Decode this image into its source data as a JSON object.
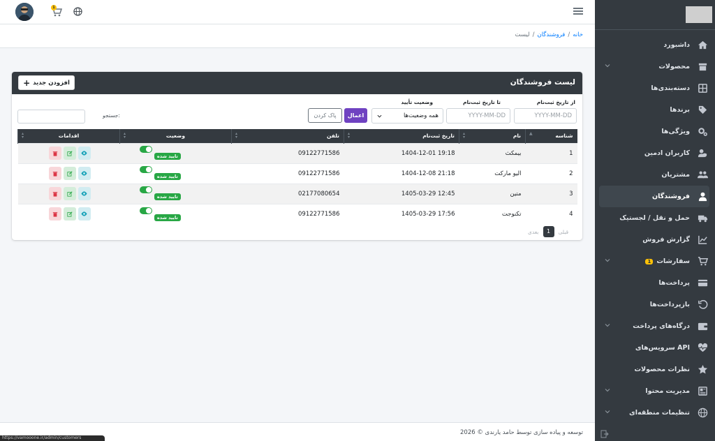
{
  "header": {
    "cart_count": "1"
  },
  "breadcrumb": {
    "home": "خانه",
    "section": "فروشندگان",
    "current": "لیست",
    "sep": "/"
  },
  "sidebar": {
    "items": [
      {
        "label": "داشبورد",
        "icon": "home-icon"
      },
      {
        "label": "محصولات",
        "icon": "box-icon"
      },
      {
        "label": "دسته‌بندی‌ها",
        "icon": "grid-icon"
      },
      {
        "label": "برندها",
        "icon": "tag-icon"
      },
      {
        "label": "ویژگی‌ها",
        "icon": "gears-icon"
      },
      {
        "label": "کاربران ادمین",
        "icon": "user-shield-icon"
      },
      {
        "label": "مشتریان",
        "icon": "users-icon"
      },
      {
        "label": "فروشندگان",
        "icon": "user-tie-icon"
      },
      {
        "label": "حمل و نقل / لجستیک",
        "icon": "truck-icon"
      },
      {
        "label": "گزارش فروش",
        "icon": "chart-line-icon"
      },
      {
        "label": "سفارشات",
        "icon": "cart-icon",
        "badge": "1"
      },
      {
        "label": "پرداخت‌ها",
        "icon": "credit-card-icon"
      },
      {
        "label": "بازپرداخت‌ها",
        "icon": "undo-icon"
      },
      {
        "label": "درگاه‌های پرداخت",
        "icon": "wallet-icon"
      },
      {
        "label": "سرویس‌های API",
        "icon": "heartbeat-icon"
      },
      {
        "label": "نظرات محصولات",
        "icon": "star-icon"
      },
      {
        "label": "مدیریت محتوا",
        "icon": "newspaper-icon"
      },
      {
        "label": "تنظیمات منطقه‌ای",
        "icon": "globe-icon"
      }
    ]
  },
  "card": {
    "title": "لیست فروشندگان",
    "add_label": "افزودن جدید",
    "filters": {
      "from_label": "از تاریخ ثبت‌نام",
      "from_placeholder": "YYYY-MM-DD",
      "to_label": "تا تاریخ ثبت‌نام",
      "to_placeholder": "YYYY-MM-DD",
      "status_label": "وضعیت تأیید",
      "status_value": "همه وضعیت‌ها",
      "apply": "اعمال",
      "clear": "پاک کردن"
    },
    "search_label": "جستجو:",
    "columns": [
      "شناسه",
      "نام",
      "تاریخ ثبت‌نام",
      "تلفن",
      "وضعیت",
      "اقدامات"
    ],
    "rows": [
      {
        "id": "1",
        "name": "بیمکث",
        "date": "1404-12-01 19:18",
        "phone": "09122771586",
        "status": "تایید شده"
      },
      {
        "id": "2",
        "name": "الیو مارکت",
        "date": "1404-12-08 21:18",
        "phone": "09122771586",
        "status": "تایید شده"
      },
      {
        "id": "3",
        "name": "متین",
        "date": "1405-03-29 12:45",
        "phone": "02177080654",
        "status": "تایید شده"
      },
      {
        "id": "4",
        "name": "تکنوجت",
        "date": "1405-03-29 17:56",
        "phone": "09122771586",
        "status": "تایید شده"
      }
    ],
    "pagination": {
      "prev": "قبلی",
      "current": "1",
      "next": "بعدی"
    }
  },
  "footer": {
    "text": "توسعه و پیاده سازی توسط حامد یارندی © 2026"
  },
  "status_url": "https://vamooone.ir/admin/customers"
}
